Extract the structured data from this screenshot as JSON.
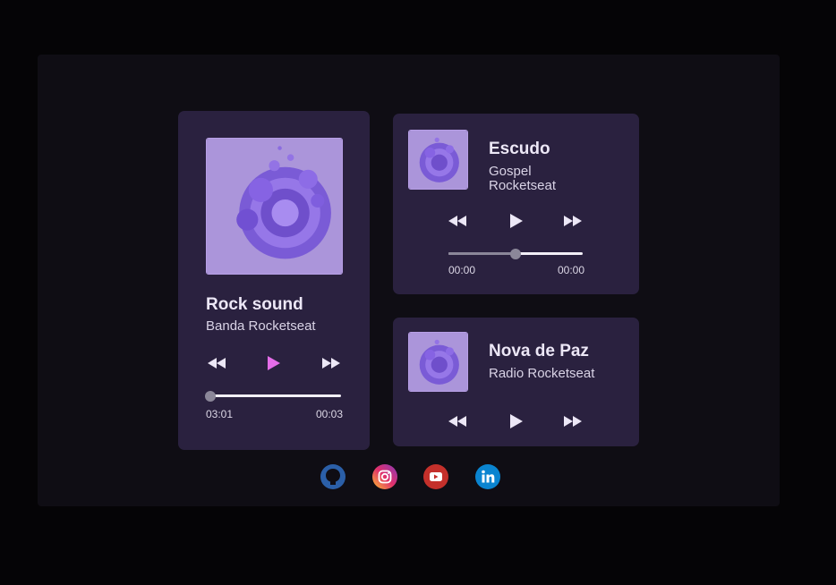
{
  "players": [
    {
      "title": "Rock sound",
      "artist": "Banda Rocketseat",
      "progress": 0.03,
      "time_current": "03:01",
      "time_total": "00:03",
      "play_color": "#e56de9"
    },
    {
      "title": "Escudo",
      "genre": "Gospel",
      "artist": "Rocketseat",
      "progress": 0.5,
      "time_current": "00:00",
      "time_total": "00:00"
    },
    {
      "title": "Nova de Paz",
      "artist": "Radio Rocketseat"
    }
  ],
  "social": [
    {
      "icon": "github-icon",
      "color": "#2b5fa8"
    },
    {
      "icon": "instagram-icon",
      "color": "#d6249f"
    },
    {
      "icon": "youtube-icon",
      "color": "#c4302b"
    },
    {
      "icon": "linkedin-icon",
      "color": "#0a84d0"
    }
  ],
  "colors": {
    "background": "#050406",
    "frame": "#0f0d14",
    "card": "#2a213f",
    "text": "#ece7f6",
    "accent": "#e56de9"
  }
}
